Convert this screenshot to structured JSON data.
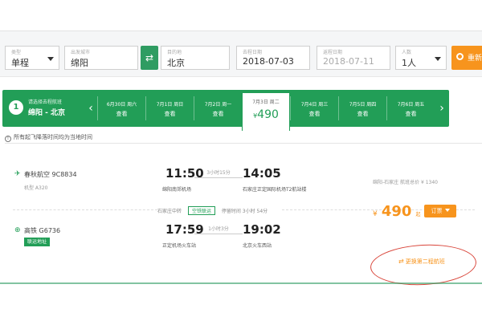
{
  "search": {
    "trip_type": {
      "label": "类型",
      "value": "单程"
    },
    "from": {
      "label": "出发城市",
      "value": "绵阳"
    },
    "to": {
      "label": "目的地",
      "value": "北京"
    },
    "depart_date": {
      "label": "去程日期",
      "value": "2018-07-03"
    },
    "return_date": {
      "label": "返程日期",
      "value": "2018-07-11"
    },
    "passengers": {
      "label": "人数",
      "value": "1人"
    },
    "search_button": "重新"
  },
  "step": {
    "number": "1",
    "title": "请选择去程航班",
    "route": "绵阳 - 北京"
  },
  "dates": [
    {
      "date": "6月30日 周六",
      "info": "查看"
    },
    {
      "date": "7月1日 周日",
      "info": "查看"
    },
    {
      "date": "7月2日 周一",
      "info": "查看"
    },
    {
      "date": "7月3日 周二",
      "info": "490",
      "currency": "¥",
      "active": true
    },
    {
      "date": "7月4日 周三",
      "info": "查看"
    },
    {
      "date": "7月5日 周四",
      "info": "查看"
    },
    {
      "date": "7月6日 周五",
      "info": "查看"
    }
  ],
  "notice": "所有起飞降落时间均为当地时间",
  "segments": [
    {
      "carrier": "春秋航空 9C8834",
      "aircraft": "机型 A320",
      "dep_time": "11:50",
      "duration": "3小时15分",
      "arr_time": "14:05",
      "dep_place": "绵阳南郊机场",
      "arr_place": "石家庄正定国际机场T2航站楼"
    },
    {
      "carrier": "高铁 G6736",
      "badge": "联运地址",
      "dep_time": "17:59",
      "duration": "1小时3分",
      "arr_time": "19:02",
      "dep_place": "正定机场火车站",
      "arr_place": "北京火车西站"
    }
  ],
  "transfer": {
    "city": "石家庄中转",
    "badge": "空铁联运",
    "wait": "停留时间 3小时 54分"
  },
  "result": {
    "route_info": "绵阳-石家庄 航班总价 ¥ 1340",
    "currency": "¥",
    "price": "490",
    "price_suffix": "起",
    "book_label": "订票",
    "next_segment_label": "更换第二程航班"
  },
  "colors": {
    "brand_green": "#229e57",
    "accent_orange": "#f7941d",
    "annotation_red": "#d9463b"
  }
}
